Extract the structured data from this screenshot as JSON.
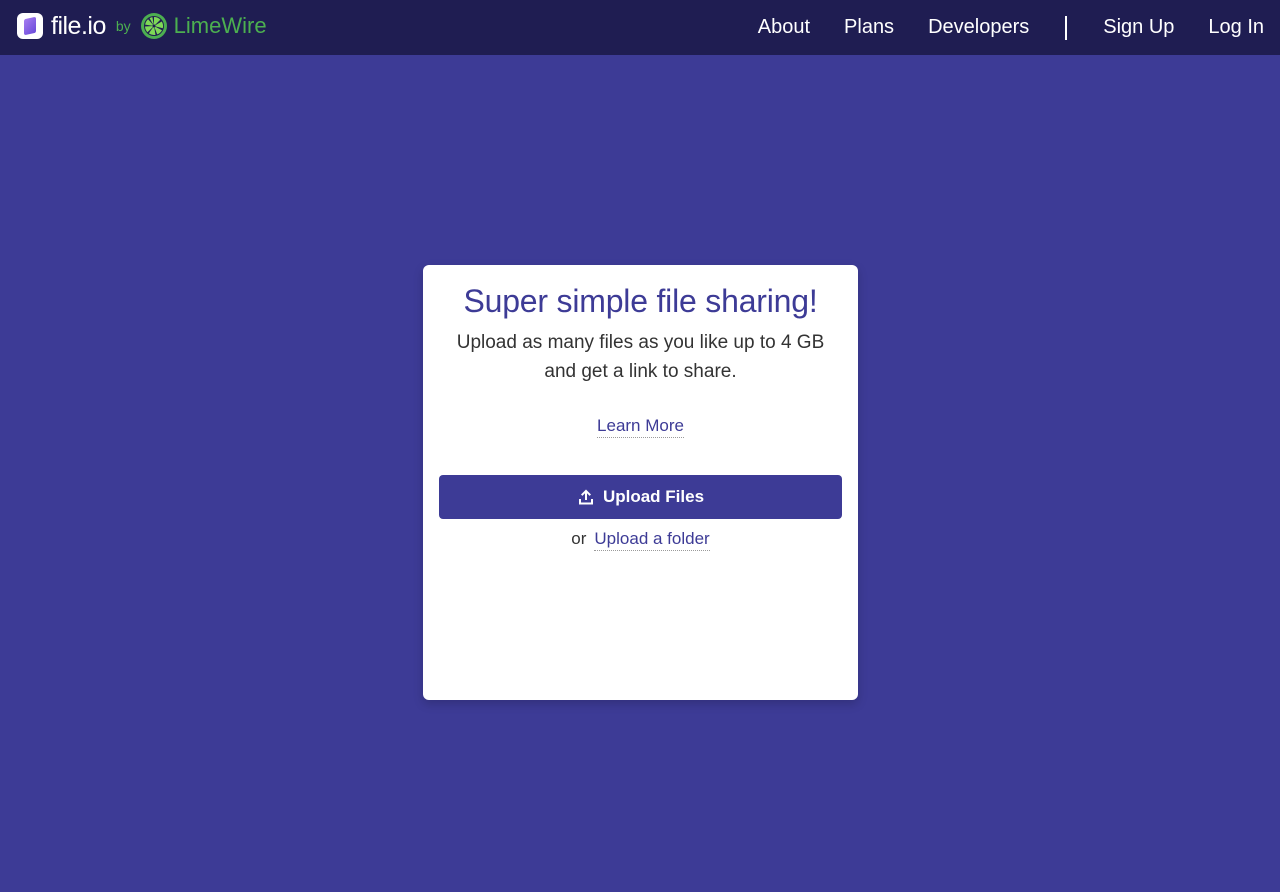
{
  "brand": {
    "logo_icon": "fileio-logo-icon",
    "name": "file.io",
    "by": "by",
    "partner_icon": "limewire-logo-icon",
    "partner": "LimeWire",
    "partner_color": "#4caf50"
  },
  "nav": {
    "items": [
      {
        "label": "About"
      },
      {
        "label": "Plans"
      },
      {
        "label": "Developers"
      }
    ],
    "sign_up": "Sign Up",
    "log_in": "Log In"
  },
  "card": {
    "title": "Super simple file sharing!",
    "subtitle": "Upload as many files as you like up to 4 GB and get a link to share.",
    "learn_more": "Learn More",
    "upload_button": "Upload Files",
    "upload_icon": "upload-icon",
    "or": "or",
    "folder_link": "Upload a folder"
  },
  "colors": {
    "background": "#3d3b96",
    "topbar": "#1f1d52",
    "accent": "#3d3b96",
    "card": "#ffffff"
  }
}
